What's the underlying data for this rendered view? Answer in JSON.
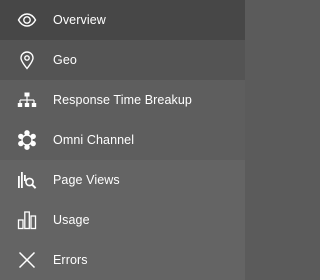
{
  "menu": {
    "items": [
      {
        "label": "Overview",
        "icon": "eye-icon"
      },
      {
        "label": "Geo",
        "icon": "map-pin-icon"
      },
      {
        "label": "Response Time Breakup",
        "icon": "hierarchy-icon"
      },
      {
        "label": "Omni Channel",
        "icon": "omni-channel-icon"
      },
      {
        "label": "Page Views",
        "icon": "page-views-search-icon"
      },
      {
        "label": "Usage",
        "icon": "bar-chart-icon"
      },
      {
        "label": "Errors",
        "icon": "close-icon"
      }
    ]
  },
  "colors": {
    "text": "#ffffff",
    "background": "#5b5b5b"
  }
}
